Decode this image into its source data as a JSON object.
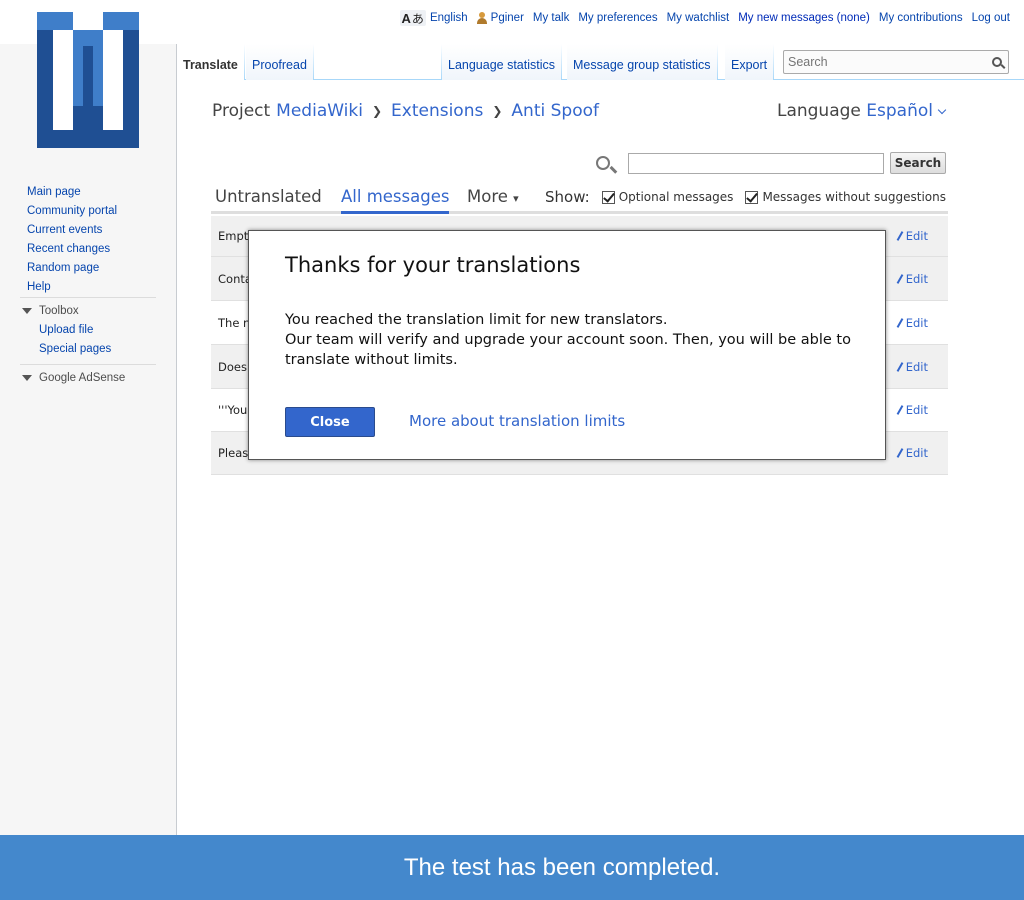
{
  "colors": {
    "link": "#0645ad",
    "accent": "#36c",
    "banner": "#4488cc",
    "logo": "#1f4f93"
  },
  "personal_tools": {
    "language_icon": "language-icon",
    "language_label": "English",
    "user_icon": "user-icon",
    "username": "Pginer",
    "items": [
      "My talk",
      "My preferences",
      "My watchlist",
      "My new messages (none)",
      "My contributions",
      "Log out"
    ]
  },
  "sidebar": {
    "navigation": [
      "Main page",
      "Community portal",
      "Current events",
      "Recent changes",
      "Random page",
      "Help"
    ],
    "toolbox": {
      "title": "Toolbox",
      "items": [
        "Upload file",
        "Special pages"
      ]
    },
    "adsense": {
      "title": "Google AdSense"
    }
  },
  "tabs": {
    "left": [
      "Translate",
      "Proofread"
    ],
    "right": [
      "Language statistics",
      "Message group statistics",
      "Export"
    ]
  },
  "search": {
    "placeholder": "Search"
  },
  "breadcrumb": {
    "prefix": "Project",
    "items": [
      "MediaWiki",
      "Extensions",
      "Anti Spoof"
    ],
    "separator": "❯"
  },
  "language_selector": {
    "label": "Language",
    "value": "Español"
  },
  "message_search": {
    "button": "Search",
    "value": ""
  },
  "filters": {
    "tabs": [
      "Untranslated",
      "All messages",
      "More"
    ],
    "more_arrow": "▾",
    "show_label": "Show:",
    "options": [
      "Optional messages",
      "Messages without suggestions"
    ]
  },
  "messages": [
    {
      "source": "Empt",
      "edit": "Edit"
    },
    {
      "source": "Conta",
      "edit": "Edit"
    },
    {
      "source": "The n",
      "edit": "Edit"
    },
    {
      "source": "Does",
      "edit": "Edit"
    },
    {
      "source": "'''You",
      "edit": "Edit"
    },
    {
      "source": "Pleas",
      "edit": "Edit"
    }
  ],
  "dialog": {
    "title": "Thanks for your translations",
    "line1": "You reached the translation limit for new translators.",
    "line2": "Our team will verify and upgrade your account soon. Then, you will be able to translate without limits.",
    "close": "Close",
    "more": "More about translation limits"
  },
  "banner": {
    "text": "The test has been completed."
  }
}
